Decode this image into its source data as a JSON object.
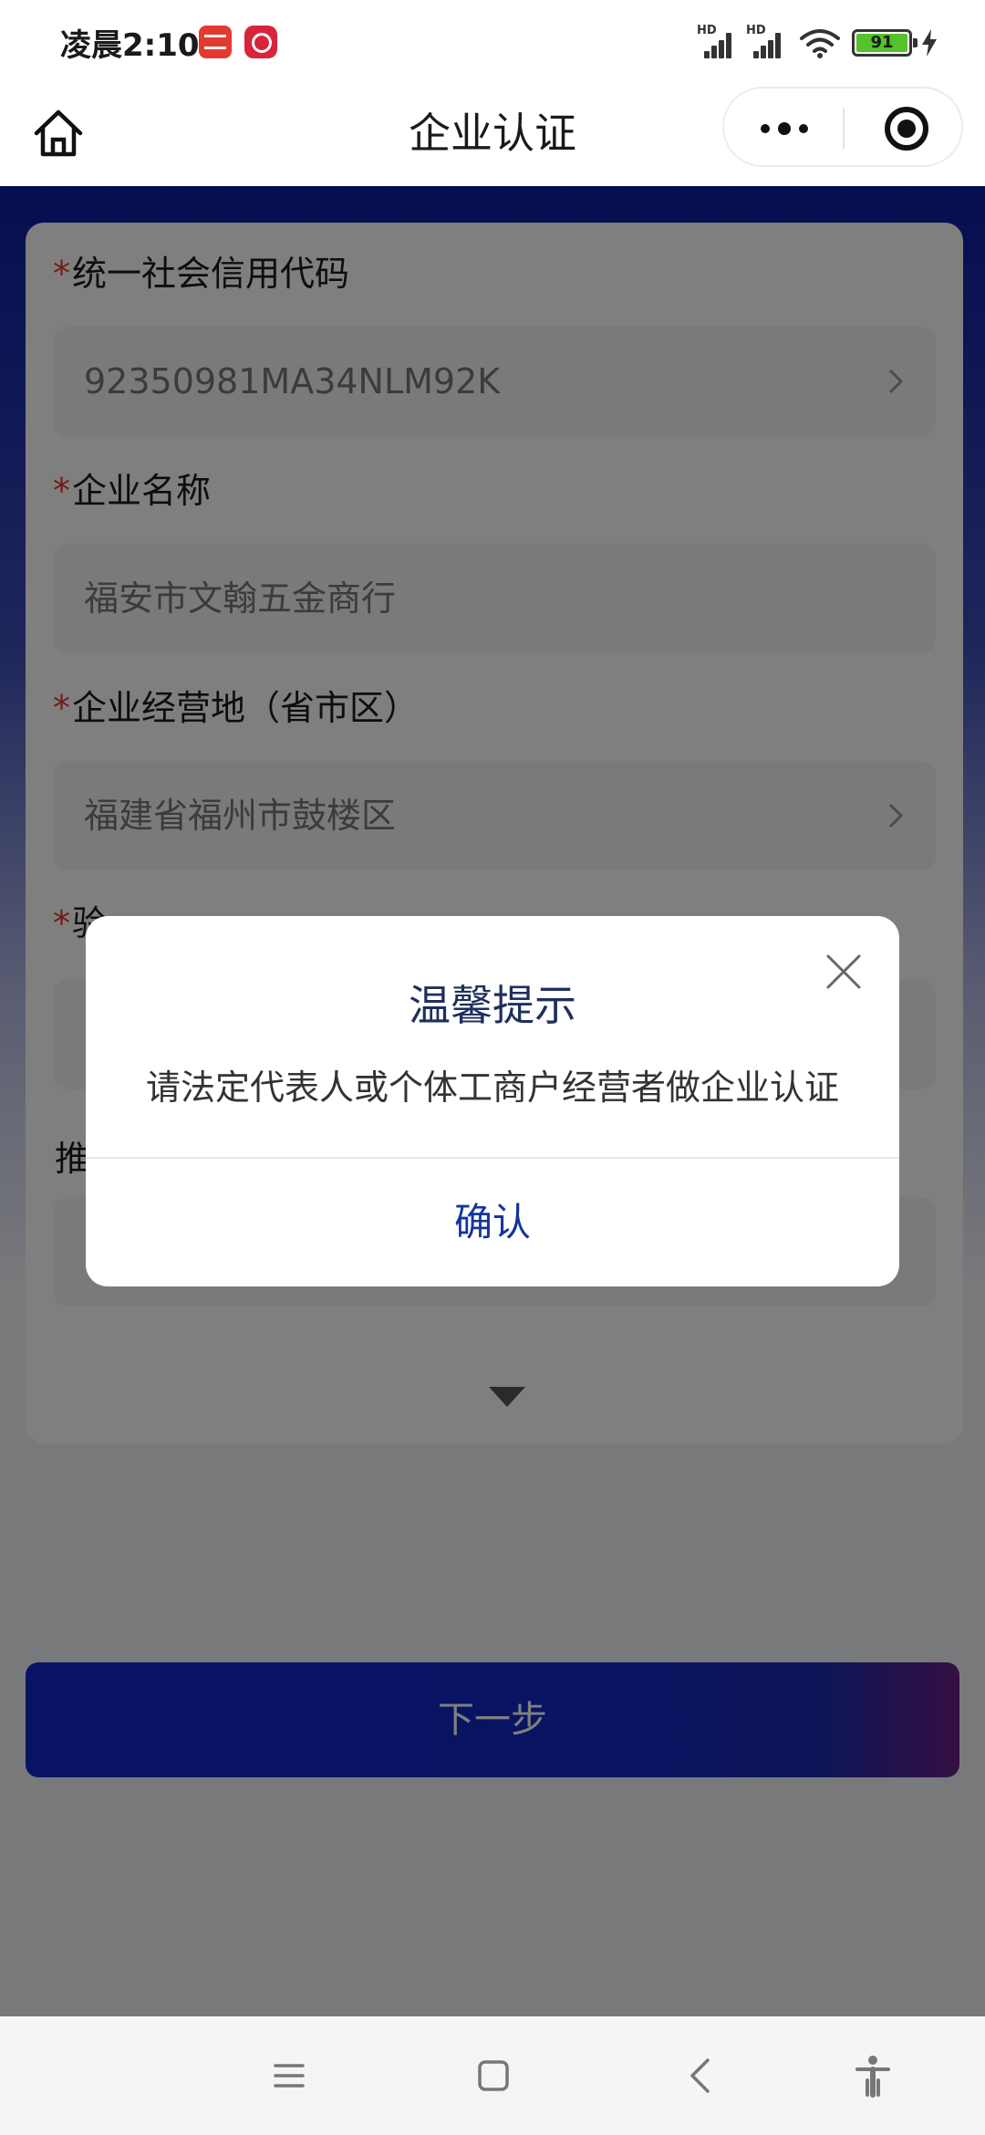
{
  "status_bar": {
    "time": "凌晨2:10",
    "battery": "91",
    "signal_label": "HD",
    "battery_color": "#55c12b"
  },
  "nav": {
    "title": "企业认证"
  },
  "form": {
    "fields": [
      {
        "label": "统一社会信用代码",
        "required": "*",
        "value": "92350981MA34NLM92K"
      },
      {
        "label": "企业名称",
        "required": "*",
        "value": "福安市文翰五金商行"
      },
      {
        "label": "企业经营地（省市区）",
        "required": "*",
        "value": "福建省福州市鼓楼区"
      },
      {
        "label": "验",
        "required": "*",
        "value": ""
      },
      {
        "label": "推",
        "required": "",
        "value": ""
      }
    ]
  },
  "next_button": {
    "label": "下一步"
  },
  "dialog": {
    "title": "温馨提示",
    "message": "请法定代表人或个体工商户经营者做企业认证",
    "confirm_label": "确认"
  },
  "colors": {
    "primary_blue": "#0a1ba0",
    "required_red": "#e23a2e",
    "confirm_text": "#14349c"
  },
  "icons": [
    "home-icon",
    "more-icon",
    "target-icon",
    "chevron-right-icon",
    "close-icon",
    "expand-icon",
    "menu-icon",
    "square-icon",
    "back-icon",
    "accessibility-icon"
  ]
}
